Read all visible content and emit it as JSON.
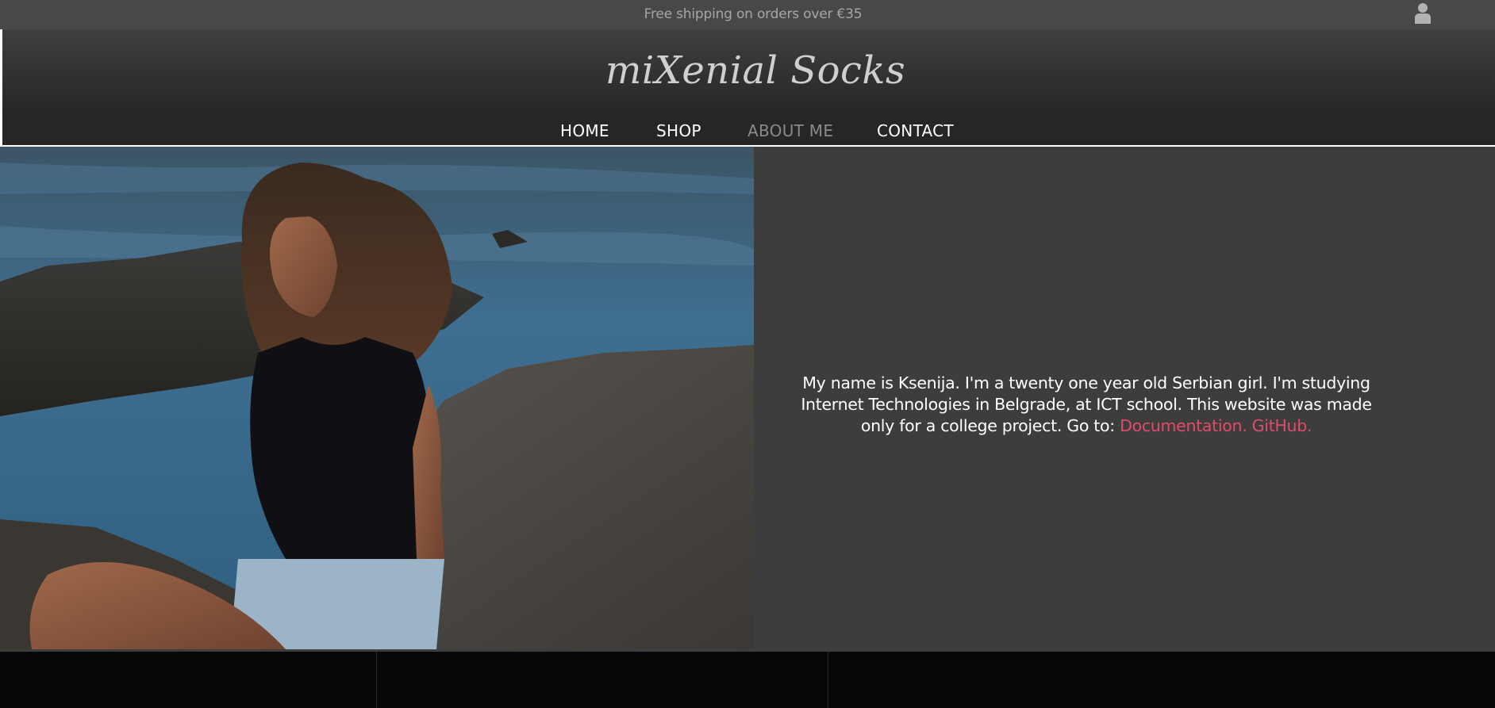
{
  "top_bar": {
    "shipping_text": "Free shipping on orders over €35",
    "user_icon": "user-icon"
  },
  "header": {
    "logo": "miXenial Socks"
  },
  "nav": {
    "items": [
      {
        "label": "HOME",
        "active": false
      },
      {
        "label": "SHOP",
        "active": false
      },
      {
        "label": "ABOUT ME",
        "active": true
      },
      {
        "label": "CONTACT",
        "active": false
      }
    ]
  },
  "about": {
    "text": "My name is Ksenija. I'm a twenty one year old Serbian girl. I'm studying Internet Technologies in Belgrade, at ICT school. This website was made only for a college project. Go to: ",
    "links": [
      {
        "label": "Documentation."
      },
      {
        "label": "GitHub."
      }
    ]
  },
  "colors": {
    "page_background": "#3d3d3d",
    "top_bar": "#484848",
    "footer": "#070707",
    "link_accent": "#e24b6b",
    "nav_active": "#8a8a8a"
  }
}
